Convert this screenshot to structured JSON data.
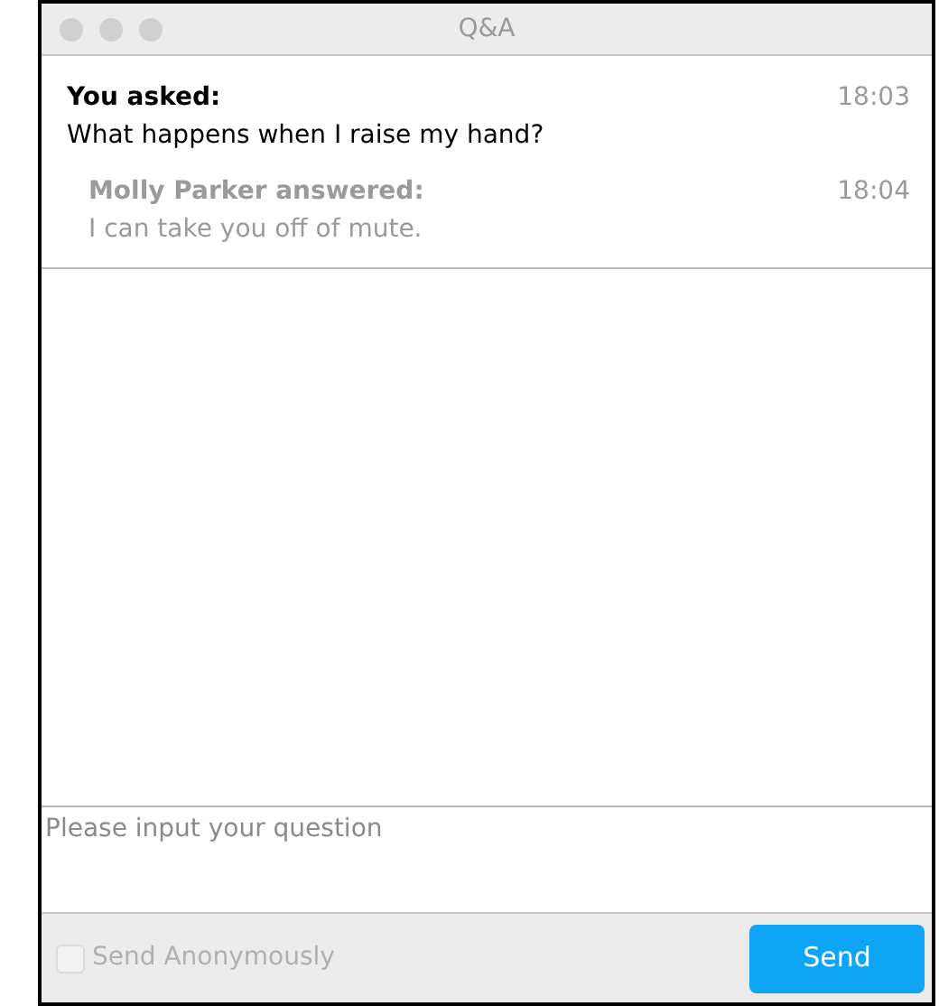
{
  "window": {
    "title": "Q&A"
  },
  "messages": [
    {
      "kind": "asked",
      "author": "You asked:",
      "time": "18:03",
      "text": "What happens when I raise my hand?"
    },
    {
      "kind": "answered",
      "author": "Molly Parker answered:",
      "time": "18:04",
      "text": "I can take you off of mute."
    }
  ],
  "question_field": {
    "placeholder": "Please input your question"
  },
  "anonymous": {
    "label": "Send Anonymously",
    "checked": false,
    "disabled": true
  },
  "send_button": {
    "label": "Send"
  }
}
